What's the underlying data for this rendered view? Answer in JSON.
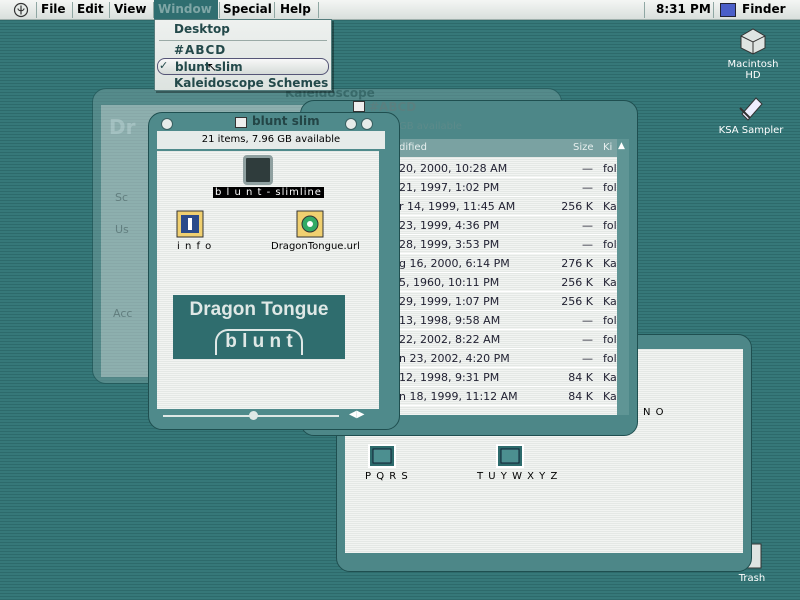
{
  "menubar": {
    "items": [
      "File",
      "Edit",
      "View",
      "Window",
      "Special",
      "Help"
    ],
    "clock": "8:31 PM",
    "app": "Finder"
  },
  "window_menu": {
    "items": [
      "Desktop",
      "#ABCD",
      "blunt slim",
      "Kaleidoscope Schemes"
    ],
    "checked": "blunt slim"
  },
  "desktop": {
    "icons": [
      "Macintosh HD",
      "KSA Sampler",
      "Trash"
    ]
  },
  "kaleidoscope_window": {
    "title": "Kaleidoscope",
    "tab_fragment": "Sc",
    "labels": [
      "Us",
      "Acc"
    ],
    "heading_fragment": "Dr"
  },
  "abcd_window": {
    "title": "#ABCD",
    "info_fragment": "GB available",
    "columns": [
      "dified",
      "Size",
      "Ki"
    ],
    "rows": [
      {
        "date": "20, 2000, 10:28 AM",
        "size": "—",
        "kind": "fol"
      },
      {
        "date": "21, 1997, 1:02 PM",
        "size": "—",
        "kind": "fol"
      },
      {
        "date": "r 14, 1999, 11:45 AM",
        "size": "256 K",
        "kind": "Ka"
      },
      {
        "date": "23, 1999, 4:36 PM",
        "size": "—",
        "kind": "fol"
      },
      {
        "date": "28, 1999, 3:53 PM",
        "size": "—",
        "kind": "fol"
      },
      {
        "date": "g 16, 2000, 6:14 PM",
        "size": "276 K",
        "kind": "Ka"
      },
      {
        "date": "5, 1960, 10:11 PM",
        "size": "256 K",
        "kind": "Ka"
      },
      {
        "date": "29, 1999, 1:07 PM",
        "size": "256 K",
        "kind": "Ka"
      },
      {
        "date": "13, 1998, 9:58 AM",
        "size": "—",
        "kind": "fol"
      },
      {
        "date": "22, 2002, 8:22 AM",
        "size": "—",
        "kind": "fol"
      },
      {
        "date": "n 23, 2002, 4:20 PM",
        "size": "—",
        "kind": "fol"
      },
      {
        "date": "12, 1998, 9:31 PM",
        "size": "84 K",
        "kind": "Ka"
      },
      {
        "date": "n 18, 1999, 11:12 AM",
        "size": "84 K",
        "kind": "Ka"
      }
    ]
  },
  "bottom_window": {
    "items": [
      "N O",
      "P Q R S",
      "T U Y W X Y Z"
    ]
  },
  "blunt_window": {
    "title": "blunt slim",
    "info": "21 items, 7.96 GB available",
    "items": [
      "b l u n t - slimline",
      "i n f o",
      "DragonTongue.url"
    ],
    "logo_line1": "Dragon Tongue",
    "logo_line2": "b l u n t"
  }
}
